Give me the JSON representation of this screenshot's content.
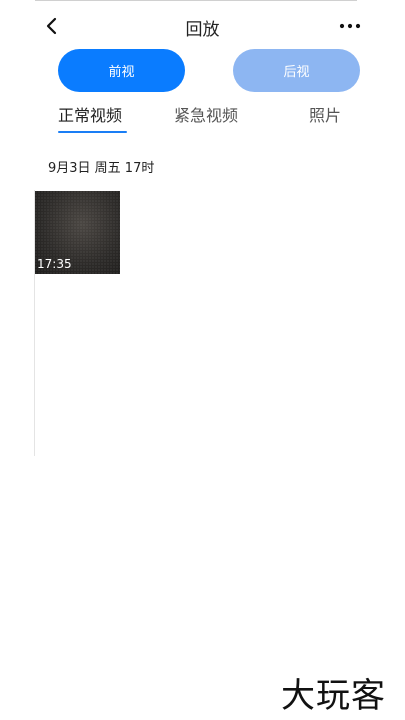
{
  "header": {
    "title": "回放",
    "back_icon": "chevron-left-icon",
    "more_icon": "more-horizontal-icon"
  },
  "camera": {
    "front_label": "前视",
    "rear_label": "后视",
    "front_color": "#0a7cff",
    "rear_color": "#8db6f2"
  },
  "tabs": [
    {
      "label": "正常视频",
      "active": true
    },
    {
      "label": "紧急视频",
      "active": false
    },
    {
      "label": "照片",
      "active": false
    }
  ],
  "accent_color": "#1a7ef5",
  "groups": [
    {
      "date": "9月3日 周五 17时",
      "items": [
        {
          "time": "17:35"
        }
      ]
    }
  ],
  "watermark": "大玩客"
}
